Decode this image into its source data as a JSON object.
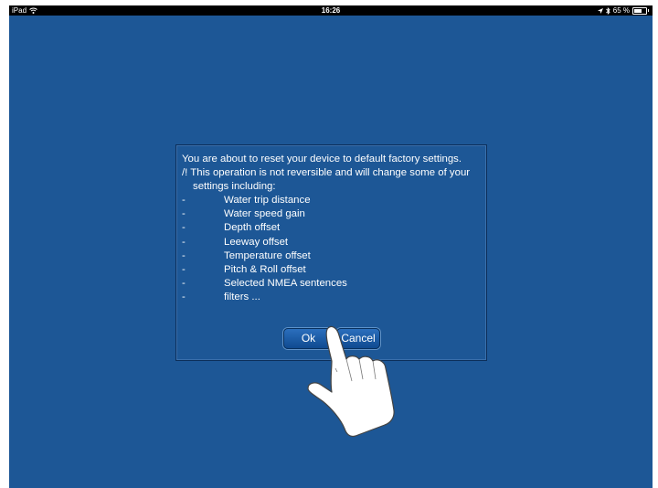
{
  "status_bar": {
    "device": "iPad",
    "time": "16:26",
    "battery_percent": "65 %",
    "battery_level": 0.65
  },
  "dialog": {
    "line1": "You are about to reset your device to default factory settings.",
    "line2": "/! This operation is not reversible and will change some of your",
    "line3": "settings including:",
    "items": [
      {
        "dash": "-",
        "label": "Water trip distance"
      },
      {
        "dash": "-",
        "label": "Water speed gain"
      },
      {
        "dash": "-",
        "label": "Depth offset"
      },
      {
        "dash": "-",
        "label": "Leeway offset"
      },
      {
        "dash": "-",
        "label": "Temperature offset"
      },
      {
        "dash": "-",
        "label": "Pitch & Roll offset"
      },
      {
        "dash": "-",
        "label": "Selected NMEA sentences"
      },
      {
        "dash": "-",
        "label": "filters ..."
      }
    ],
    "ok_label": "Ok",
    "cancel_label": "Cancel"
  },
  "colors": {
    "background": "#1d5796",
    "status_bar": "#000000",
    "text": "#ffffff"
  }
}
